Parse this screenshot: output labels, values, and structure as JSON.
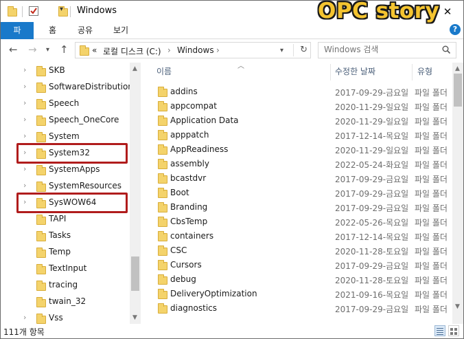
{
  "window": {
    "title": "Windows",
    "controls": {
      "minimize": "—",
      "maximize": "☐",
      "close": "✕"
    }
  },
  "ribbon": {
    "tabs": [
      {
        "label": "파일"
      },
      {
        "label": "홈"
      },
      {
        "label": "공유"
      },
      {
        "label": "보기"
      }
    ],
    "brand": "OPC story",
    "help": "?"
  },
  "address": {
    "overflow": "«",
    "crumbs": [
      "로컬 디스크 (C:)",
      "Windows"
    ],
    "separator": "›"
  },
  "search": {
    "placeholder": "Windows 검색"
  },
  "nav": {
    "items": [
      {
        "label": "SKB",
        "expandable": true
      },
      {
        "label": "SoftwareDistribution",
        "expandable": true
      },
      {
        "label": "Speech",
        "expandable": true
      },
      {
        "label": "Speech_OneCore",
        "expandable": true
      },
      {
        "label": "System",
        "expandable": true
      },
      {
        "label": "System32",
        "expandable": true,
        "highlighted": true
      },
      {
        "label": "SystemApps",
        "expandable": true
      },
      {
        "label": "SystemResources",
        "expandable": true
      },
      {
        "label": "SysWOW64",
        "expandable": true,
        "highlighted": true
      },
      {
        "label": "TAPI",
        "expandable": false
      },
      {
        "label": "Tasks",
        "expandable": false
      },
      {
        "label": "Temp",
        "expandable": false
      },
      {
        "label": "TextInput",
        "expandable": false
      },
      {
        "label": "tracing",
        "expandable": false
      },
      {
        "label": "twain_32",
        "expandable": false
      },
      {
        "label": "Vss",
        "expandable": true
      }
    ]
  },
  "columns": {
    "name": "이름",
    "date": "수정한 날짜",
    "type": "유형"
  },
  "files": [
    {
      "name": "addins",
      "date": "2017-09-29-금요일",
      "type": "파일 폴더"
    },
    {
      "name": "appcompat",
      "date": "2020-11-29-일요일",
      "type": "파일 폴더"
    },
    {
      "name": "Application Data",
      "date": "2020-11-29-일요일",
      "type": "파일 폴더"
    },
    {
      "name": "apppatch",
      "date": "2017-12-14-목요일",
      "type": "파일 폴더"
    },
    {
      "name": "AppReadiness",
      "date": "2020-11-29-일요일",
      "type": "파일 폴더"
    },
    {
      "name": "assembly",
      "date": "2022-05-24-화요일",
      "type": "파일 폴더"
    },
    {
      "name": "bcastdvr",
      "date": "2017-09-29-금요일",
      "type": "파일 폴더"
    },
    {
      "name": "Boot",
      "date": "2017-09-29-금요일",
      "type": "파일 폴더"
    },
    {
      "name": "Branding",
      "date": "2017-09-29-금요일",
      "type": "파일 폴더"
    },
    {
      "name": "CbsTemp",
      "date": "2022-05-26-목요일",
      "type": "파일 폴더"
    },
    {
      "name": "containers",
      "date": "2017-12-14-목요일",
      "type": "파일 폴더"
    },
    {
      "name": "CSC",
      "date": "2020-11-28-토요일",
      "type": "파일 폴더"
    },
    {
      "name": "Cursors",
      "date": "2017-09-29-금요일",
      "type": "파일 폴더"
    },
    {
      "name": "debug",
      "date": "2020-11-28-토요일",
      "type": "파일 폴더"
    },
    {
      "name": "DeliveryOptimization",
      "date": "2021-09-16-목요일",
      "type": "파일 폴더"
    },
    {
      "name": "diagnostics",
      "date": "2017-09-29-금요일",
      "type": "파일 폴더"
    }
  ],
  "status": {
    "count": "111개 항목"
  },
  "colors": {
    "accent": "#1979ca",
    "highlight_box": "#b01c1c",
    "folder": "#f4d36b",
    "brand": "#f4c430"
  }
}
